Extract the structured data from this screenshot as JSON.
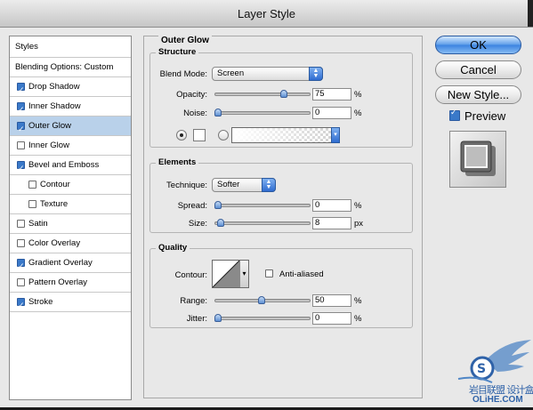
{
  "window": {
    "title": "Layer Style"
  },
  "sidebar": {
    "header": "Styles",
    "blending": "Blending Options: Custom",
    "items": [
      {
        "label": "Drop Shadow",
        "checked": true,
        "selected": false,
        "indent": false
      },
      {
        "label": "Inner Shadow",
        "checked": true,
        "selected": false,
        "indent": false
      },
      {
        "label": "Outer Glow",
        "checked": true,
        "selected": true,
        "indent": false
      },
      {
        "label": "Inner Glow",
        "checked": false,
        "selected": false,
        "indent": false
      },
      {
        "label": "Bevel and Emboss",
        "checked": true,
        "selected": false,
        "indent": false
      },
      {
        "label": "Contour",
        "checked": false,
        "selected": false,
        "indent": true
      },
      {
        "label": "Texture",
        "checked": false,
        "selected": false,
        "indent": true
      },
      {
        "label": "Satin",
        "checked": false,
        "selected": false,
        "indent": false
      },
      {
        "label": "Color Overlay",
        "checked": false,
        "selected": false,
        "indent": false
      },
      {
        "label": "Gradient Overlay",
        "checked": true,
        "selected": false,
        "indent": false
      },
      {
        "label": "Pattern Overlay",
        "checked": false,
        "selected": false,
        "indent": false
      },
      {
        "label": "Stroke",
        "checked": true,
        "selected": false,
        "indent": false
      }
    ]
  },
  "panel": {
    "title": "Outer Glow",
    "structure": {
      "title": "Structure",
      "blend_mode_label": "Blend Mode:",
      "blend_mode_value": "Screen",
      "opacity_label": "Opacity:",
      "opacity_value": "75",
      "opacity_fraction": 0.75,
      "opacity_unit": "%",
      "noise_label": "Noise:",
      "noise_value": "0",
      "noise_fraction": 0,
      "noise_unit": "%",
      "color_mode": "solid"
    },
    "elements": {
      "title": "Elements",
      "technique_label": "Technique:",
      "technique_value": "Softer",
      "spread_label": "Spread:",
      "spread_value": "0",
      "spread_fraction": 0,
      "spread_unit": "%",
      "size_label": "Size:",
      "size_value": "8",
      "size_fraction": 0.03,
      "size_unit": "px"
    },
    "quality": {
      "title": "Quality",
      "contour_label": "Contour:",
      "antialiased_label": "Anti-aliased",
      "antialiased_checked": false,
      "range_label": "Range:",
      "range_value": "50",
      "range_fraction": 0.5,
      "range_unit": "%",
      "jitter_label": "Jitter:",
      "jitter_value": "0",
      "jitter_fraction": 0,
      "jitter_unit": "%"
    }
  },
  "buttons": {
    "ok": "OK",
    "cancel": "Cancel",
    "new_style": "New Style..."
  },
  "preview": {
    "label": "Preview",
    "checked": true
  },
  "watermark": {
    "text": "OLiHE.COM",
    "chars": "岩目联盟 设计盒子"
  },
  "colors": {
    "selected_row": "#b9d1ea",
    "accent": "#3a82e0",
    "check": "#3a79c9"
  }
}
